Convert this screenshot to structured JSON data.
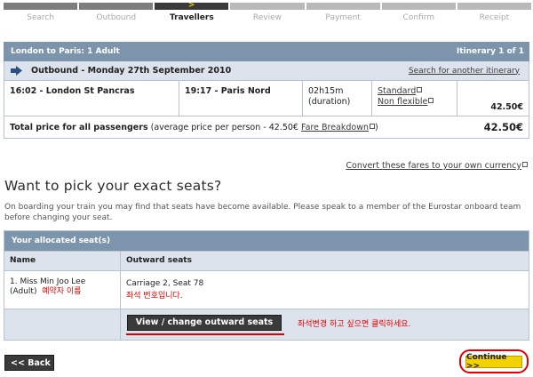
{
  "progress": {
    "steps": [
      {
        "label": "Search"
      },
      {
        "label": "Outbound"
      },
      {
        "label": "Travellers",
        "active": true
      },
      {
        "label": "Review"
      },
      {
        "label": "Payment"
      },
      {
        "label": "Confirm"
      },
      {
        "label": "Receipt"
      }
    ],
    "current_marker": ">"
  },
  "itinerary": {
    "title": "London to Paris: 1 Adult",
    "count": "Itinerary 1 of 1",
    "outbound_label": "Outbound - Monday 27th September 2010",
    "search_another": "Search for another itinerary",
    "train": {
      "depart": "16:02 - London St Pancras",
      "arrive": "19:17 - Paris Nord",
      "duration": "02h15m",
      "duration_note": "(duration)",
      "class": "Standard",
      "fare_type": "Non flexible",
      "price": "42.50€"
    },
    "total_label": "Total price for all passengers",
    "total_note": "(average price per person - 42.50€",
    "fare_breakdown": "Fare Breakdown",
    "total_close": ")",
    "total_price": "42.50€"
  },
  "convert_link": "Convert these fares to your own currency",
  "seats_section": {
    "heading": "Want to pick your exact seats?",
    "description": "On boarding your train you may find that seats have become available. Please speak to a member of the Eurostar onboard team before changing your seat.",
    "table_title": "Your allocated seat(s)",
    "col_name": "Name",
    "col_outward": "Outward seats",
    "passenger_name": "1. Miss Min Joo Lee",
    "passenger_type": "(Adult)",
    "passenger_note_kr": "예약자 이름",
    "seat": "Carriage 2, Seat 78",
    "seat_note_kr": "좌석 번호입니다.",
    "view_change_button": "View / change outward seats",
    "change_note_kr": "좌석변경 하고 싶으면 클릭하세요."
  },
  "nav": {
    "back": "<< Back",
    "continue": "Continue >>"
  },
  "colors": {
    "header_blue": "#7d94ad",
    "row_blue": "#dde3ec",
    "annotation_red": "#e00000",
    "continue_yellow": "#f2d200"
  }
}
